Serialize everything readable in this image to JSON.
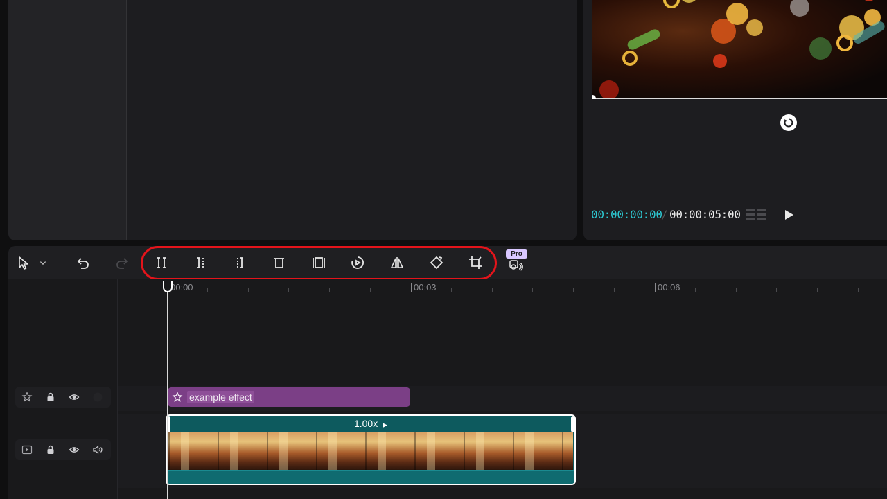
{
  "player": {
    "current_time": "00:00:00:00",
    "separator": "/",
    "total_time": "00:00:05:00",
    "icons": {
      "rotate": "rotate-icon",
      "grid": "grid-icon",
      "play": "play-icon"
    }
  },
  "toolbar": {
    "tools": [
      {
        "name": "select-tool",
        "icon": "cursor-icon"
      },
      {
        "name": "select-dropdown",
        "icon": "chevron-down-icon"
      },
      {
        "name": "undo",
        "icon": "undo-icon"
      },
      {
        "name": "redo",
        "icon": "redo-icon"
      },
      {
        "name": "split",
        "icon": "split-icon"
      },
      {
        "name": "split-left",
        "icon": "trim-left-icon"
      },
      {
        "name": "split-right",
        "icon": "trim-right-icon"
      },
      {
        "name": "delete",
        "icon": "trash-icon"
      },
      {
        "name": "freeze",
        "icon": "freeze-frame-icon"
      },
      {
        "name": "reverse",
        "icon": "reverse-icon"
      },
      {
        "name": "mirror",
        "icon": "mirror-icon"
      },
      {
        "name": "rotate",
        "icon": "rotate-icon"
      },
      {
        "name": "crop",
        "icon": "crop-icon"
      },
      {
        "name": "voice-changer",
        "icon": "voice-effect-icon"
      }
    ],
    "pro_badge": "Pro"
  },
  "timeline": {
    "ruler": [
      "00:00",
      "00:03",
      "00:06"
    ],
    "effect_track": {
      "clip_label": "example effect"
    },
    "video_track": {
      "speed_label": "1.00x"
    }
  },
  "colors": {
    "accent": "#2dc6d0",
    "effect_clip": "#7b3f86",
    "video_clip": "#0d5a5e",
    "highlight": "#e4141b"
  }
}
